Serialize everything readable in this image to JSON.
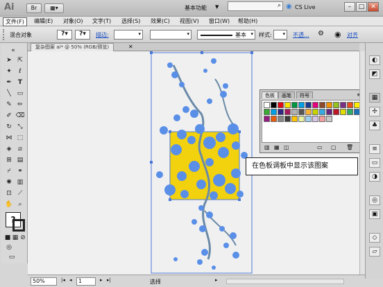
{
  "app": {
    "logo": "Ai",
    "workspace": "基本功能",
    "cs_live": "CS Live"
  },
  "window_buttons": {
    "minimize": "–",
    "maximize": "□",
    "close": "✕"
  },
  "menus": [
    "文件(F)",
    "编辑(E)",
    "对象(O)",
    "文字(T)",
    "选择(S)",
    "效果(C)",
    "视图(V)",
    "窗口(W)",
    "帮助(H)"
  ],
  "control_bar": {
    "selection": "混合对象",
    "stroke_label": "描边:",
    "stroke_style": "基本",
    "style_label": "样式:",
    "opacity_label": "不透...",
    "align_label": "对齐"
  },
  "doc_tab": "复杂图案 ai* @ 50% (RGB/预览)",
  "swatch_panel": {
    "tabs": [
      "色板",
      "画笔",
      "符号"
    ]
  },
  "callout": "在色板调板中显示该图案",
  "status": {
    "zoom": "50%",
    "page": "1",
    "mode": "选择"
  },
  "colors": {
    "accent": "#5a8fe8",
    "yellow": "#f2d10e"
  }
}
